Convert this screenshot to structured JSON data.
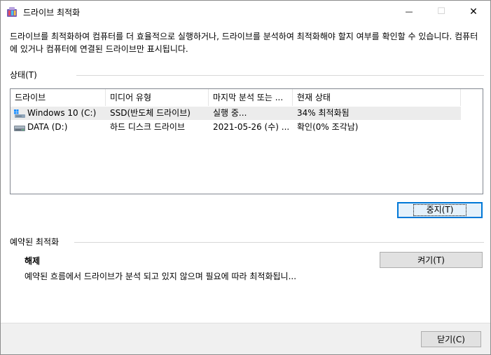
{
  "window": {
    "title": "드라이브 최적화",
    "minimize_glyph": "—",
    "maximize_glyph": "☐",
    "close_glyph": "✕"
  },
  "description": "드라이브를 최적화하여 컴퓨터를 더 효율적으로 실행하거나, 드라이브를 분석하여 최적화해야 할지 여부를 확인할 수 있습니다. 컴퓨터에 있거나 컴퓨터에 연결된 드라이브만 표시됩니다.",
  "status_section": {
    "label": "상태(T)",
    "columns": [
      "드라이브",
      "미디어 유형",
      "마지막 분석 또는 ...",
      "현재 상태"
    ],
    "rows": [
      {
        "drive": "Windows 10 (C:)",
        "media": "SSD(반도체 드라이브)",
        "last": "실행 중...",
        "status": "34% 최적화됨",
        "icon": "windows-drive-icon",
        "selected": true
      },
      {
        "drive": "DATA (D:)",
        "media": "하드 디스크 드라이브",
        "last": "2021-05-26 (수) ...",
        "status": "확인(0% 조각남)",
        "icon": "hard-drive-icon",
        "selected": false
      }
    ],
    "stop_button": "중지(T)"
  },
  "scheduled_section": {
    "label": "예약된 최적화",
    "state": "해제",
    "info": "예약된 흐름에서 드라이브가 분석 되고 있지 않으며 필요에 따라 최적화됩니...",
    "on_button": "켜기(T)"
  },
  "footer": {
    "close_button": "닫기(C)"
  },
  "colors": {
    "accent": "#0078d7",
    "selected_row": "#ececec",
    "button_face": "#e1e1e1"
  }
}
